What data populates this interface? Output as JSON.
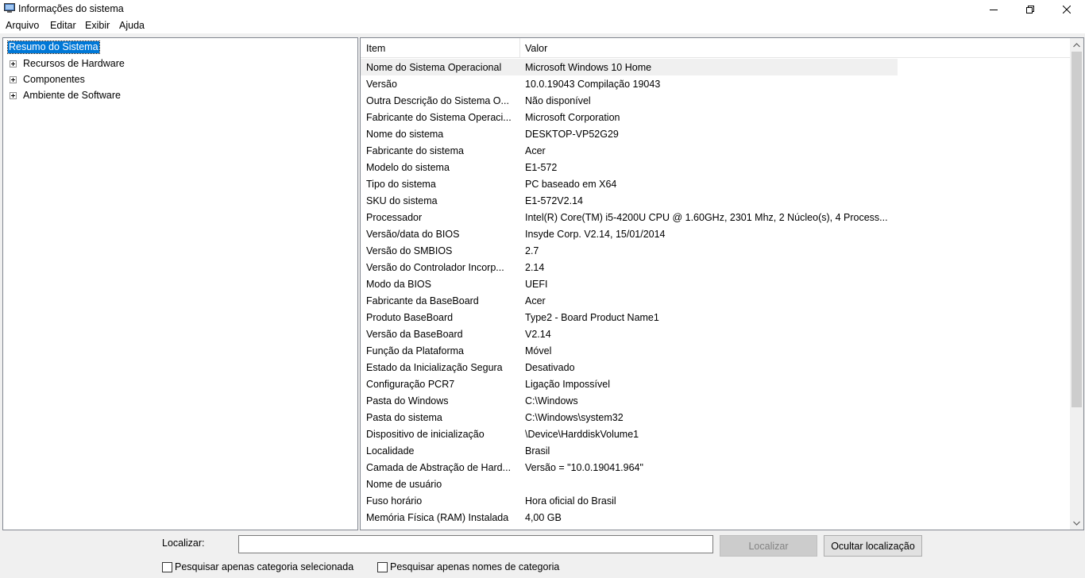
{
  "window": {
    "title": "Informações do sistema"
  },
  "menu": [
    "Arquivo",
    "Editar",
    "Exibir",
    "Ajuda"
  ],
  "tree": {
    "root": "Resumo do Sistema",
    "children": [
      "Recursos de Hardware",
      "Componentes",
      "Ambiente de Software"
    ]
  },
  "list": {
    "columns": [
      "Item",
      "Valor"
    ],
    "rows": [
      {
        "item": "Nome do Sistema Operacional",
        "value": "Microsoft Windows 10 Home"
      },
      {
        "item": "Versão",
        "value": "10.0.19043 Compilação 19043"
      },
      {
        "item": "Outra Descrição do Sistema O...",
        "value": "Não disponível"
      },
      {
        "item": "Fabricante do Sistema Operaci...",
        "value": "Microsoft Corporation"
      },
      {
        "item": "Nome do sistema",
        "value": "DESKTOP-VP52G29"
      },
      {
        "item": "Fabricante do sistema",
        "value": "Acer"
      },
      {
        "item": "Modelo do sistema",
        "value": "E1-572"
      },
      {
        "item": "Tipo do sistema",
        "value": "PC baseado em X64"
      },
      {
        "item": "SKU do sistema",
        "value": "E1-572V2.14"
      },
      {
        "item": "Processador",
        "value": "Intel(R) Core(TM) i5-4200U CPU @ 1.60GHz, 2301 Mhz, 2 Núcleo(s), 4 Process..."
      },
      {
        "item": "Versão/data do BIOS",
        "value": "Insyde Corp. V2.14, 15/01/2014"
      },
      {
        "item": "Versão do SMBIOS",
        "value": "2.7"
      },
      {
        "item": "Versão do Controlador Incorp...",
        "value": "2.14"
      },
      {
        "item": "Modo da BIOS",
        "value": "UEFI"
      },
      {
        "item": "Fabricante da BaseBoard",
        "value": "Acer"
      },
      {
        "item": "Produto BaseBoard",
        "value": "Type2 - Board Product Name1"
      },
      {
        "item": "Versão da BaseBoard",
        "value": "V2.14"
      },
      {
        "item": "Função da Plataforma",
        "value": "Móvel"
      },
      {
        "item": "Estado da Inicialização Segura",
        "value": "Desativado"
      },
      {
        "item": "Configuração PCR7",
        "value": "Ligação Impossível"
      },
      {
        "item": "Pasta do Windows",
        "value": "C:\\Windows"
      },
      {
        "item": "Pasta do sistema",
        "value": "C:\\Windows\\system32"
      },
      {
        "item": "Dispositivo de inicialização",
        "value": "\\Device\\HarddiskVolume1"
      },
      {
        "item": "Localidade",
        "value": "Brasil"
      },
      {
        "item": "Camada de Abstração de Hard...",
        "value": "Versão = \"10.0.19041.964\""
      },
      {
        "item": "Nome de usuário",
        "value": ""
      },
      {
        "item": "Fuso horário",
        "value": "Hora oficial do Brasil"
      },
      {
        "item": "Memória Física (RAM) Instalada",
        "value": "4,00 GB"
      }
    ]
  },
  "search": {
    "label": "Localizar:",
    "input_value": "",
    "find_button": "Localizar",
    "hide_button": "Ocultar localização",
    "checkbox_selected_category": "Pesquisar apenas categoria selecionada",
    "checkbox_category_names": "Pesquisar apenas nomes de categoria"
  },
  "colors": {
    "selection": "#0078d7",
    "window_bg": "#f0f0f0",
    "border": "#828790"
  }
}
